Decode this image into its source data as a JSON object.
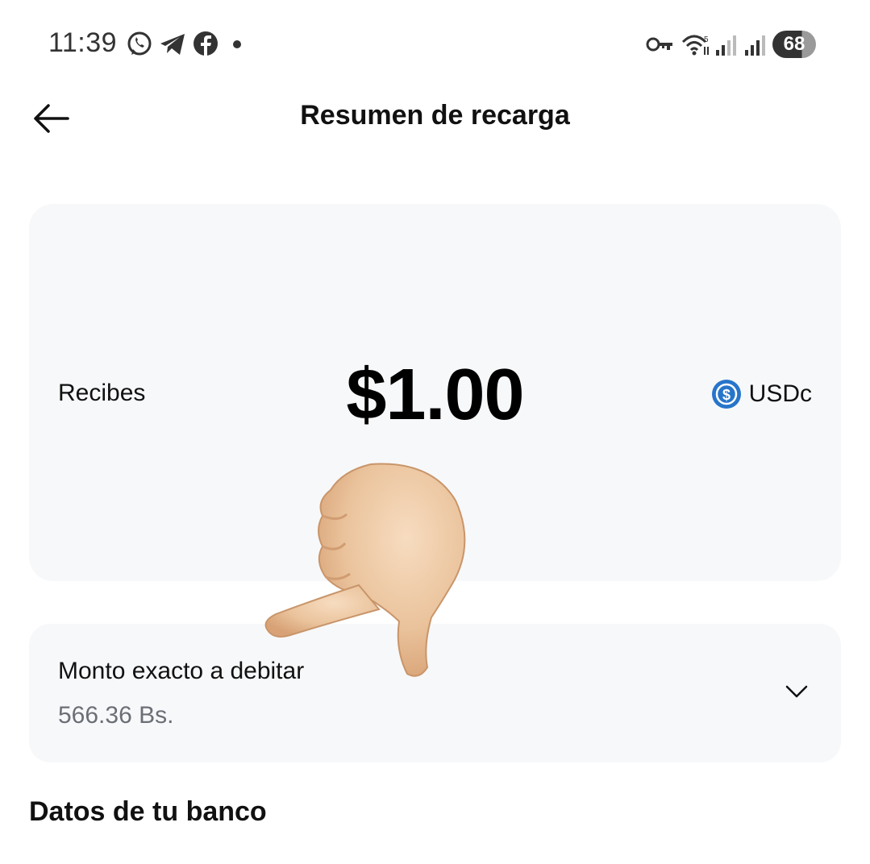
{
  "status_bar": {
    "time": "11:39",
    "notification_icons": [
      "whatsapp-icon",
      "telegram-icon",
      "facebook-icon",
      "dot-icon"
    ],
    "system_icons": [
      "vpn-key-icon",
      "wifi-icon",
      "signal-icon",
      "signal-icon"
    ],
    "battery": "68"
  },
  "header": {
    "title": "Resumen de recarga",
    "back_icon": "arrow-left-icon"
  },
  "receive": {
    "label": "Recibes",
    "amount": "$1.00",
    "currency": "USDc",
    "currency_icon": "usdc-coin-icon"
  },
  "debit": {
    "label": "Monto exacto a debitar",
    "value": "566.36 Bs.",
    "expand_icon": "chevron-down-icon"
  },
  "bank_section": {
    "title": "Datos de tu banco"
  },
  "overlay": {
    "icon": "thumbs-down-hand-icon"
  },
  "colors": {
    "card_background": "#f7f8fa",
    "usdc_blue": "#2775ca",
    "secondary_text": "#6b6f75"
  }
}
